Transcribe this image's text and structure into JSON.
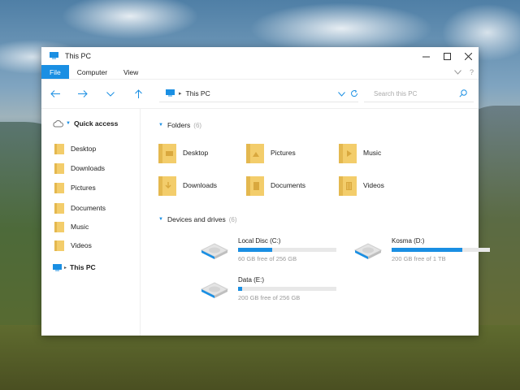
{
  "window": {
    "title": "This PC"
  },
  "ribbon": {
    "tabs": [
      {
        "label": "File",
        "active": true
      },
      {
        "label": "Computer",
        "active": false
      },
      {
        "label": "View",
        "active": false
      }
    ]
  },
  "address": {
    "path": "This PC"
  },
  "search": {
    "placeholder": "Search this PC"
  },
  "sidebar": {
    "quick_access": "Quick access",
    "items": [
      "Desktop",
      "Downloads",
      "Pictures",
      "Documents",
      "Music",
      "Videos"
    ],
    "this_pc": "This PC"
  },
  "folders": {
    "title": "Folders",
    "count": "(6)",
    "items": [
      {
        "label": "Desktop",
        "icon": "desktop-folder-icon"
      },
      {
        "label": "Pictures",
        "icon": "pictures-folder-icon"
      },
      {
        "label": "Music",
        "icon": "music-folder-icon"
      },
      {
        "label": "Downloads",
        "icon": "downloads-folder-icon"
      },
      {
        "label": "Documents",
        "icon": "documents-folder-icon"
      },
      {
        "label": "Videos",
        "icon": "videos-folder-icon"
      }
    ]
  },
  "drives": {
    "title": "Devices and drives",
    "count": "(6)",
    "items": [
      {
        "name": "Local Disc (C:)",
        "free": "60 GB free of 256 GB",
        "used_fraction": 0.35
      },
      {
        "name": "Kosma (D:)",
        "free": "200 GB free of 1 TB",
        "used_fraction": 0.72
      },
      {
        "name": "Data (E:)",
        "free": "200 GB free of 256 GB",
        "used_fraction": 0.04
      }
    ]
  },
  "colors": {
    "accent": "#1a8fe3",
    "folder": "#f3cd6b"
  }
}
